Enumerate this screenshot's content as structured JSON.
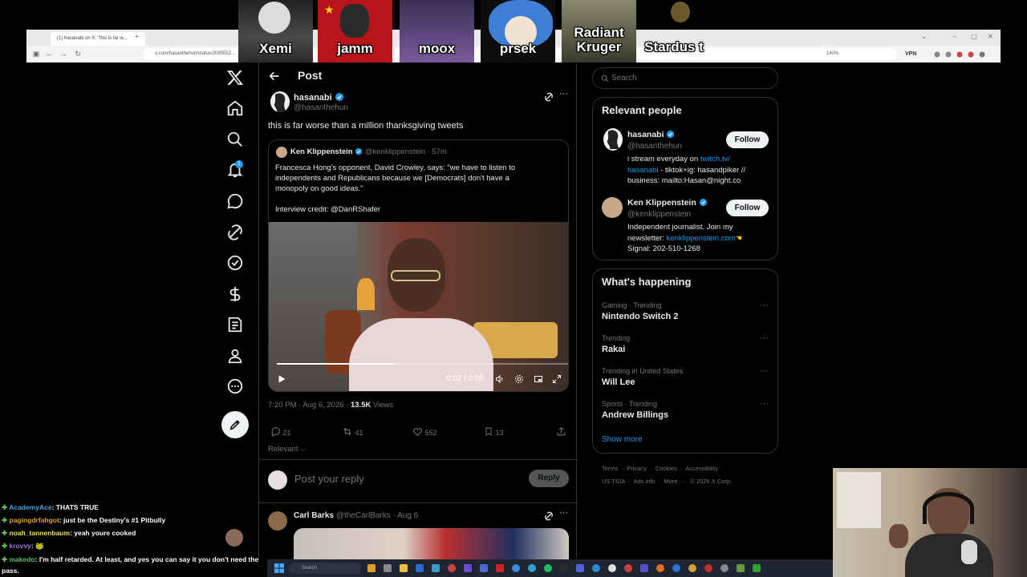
{
  "browser": {
    "tab_title": "(1) hasanabi on X: \"this is far w...",
    "url": "x.com/hasanthehun/status/2085552...",
    "zoom": "140%",
    "vpn": "VPN"
  },
  "streamer_tiles": [
    {
      "name": "Xemi",
      "color": "#3a3a3a"
    },
    {
      "name": "jamm",
      "color": "#b8141c"
    },
    {
      "name": "moox",
      "color": "#5a4a7a"
    },
    {
      "name": "prsek",
      "color": "#3d7fd6"
    },
    {
      "name": "Radiant Kruger",
      "color": "#6a6a58"
    },
    {
      "name": "Stardus t",
      "color": "#111111"
    }
  ],
  "nav": {
    "items": [
      "x-logo-icon",
      "home-icon",
      "search-icon",
      "notifications-icon",
      "messages-icon",
      "grok-icon",
      "verified-icon",
      "monetization-icon",
      "articles-icon",
      "profile-icon",
      "more-icon"
    ],
    "notification_count": "1",
    "post_button_icon": "compose-icon"
  },
  "header": {
    "title": "Post"
  },
  "post": {
    "author_name": "hasanabi",
    "author_handle": "@hasanthehun",
    "text": "this is far worse than a million thanksgiving tweets",
    "timestamp": "7:20 PM · Aug 6, 2026 · ",
    "views_count": "13.5K",
    "views_label": " Views",
    "quote": {
      "author_name": "Ken Klippenstein",
      "author_handle": "@kenklippenstein",
      "time": "· 57m",
      "text_line1": "Francesca Hong's opponent, David Crowley, says: \"we have to listen to",
      "text_line2": "independents and Republicans because we [Democrats] don't have a",
      "text_line3": "monopoly on good ideas.\"",
      "credit": "Interview credit: @DanRShafer"
    },
    "video": {
      "time": "0:02 / 0:05",
      "progress": 0.4
    },
    "actions": {
      "replies": "21",
      "reposts": "41",
      "likes": "552",
      "bookmarks": "13"
    },
    "sort_label": "Relevant"
  },
  "reply_box": {
    "placeholder": "Post your reply",
    "button": "Reply"
  },
  "reply_post": {
    "author_name": "Carl Barks",
    "author_handle": "@theCarlBarks",
    "time": "· Aug 6"
  },
  "search": {
    "placeholder": "Search"
  },
  "relevant_people": {
    "title": "Relevant people",
    "people": [
      {
        "name": "hasanabi",
        "handle": "@hasanthehun",
        "follow": "Follow",
        "bio1": "i stream everyday on ",
        "bio_link1": "twitch.tv/",
        "bio_link2": "hasanabi",
        "bio2": " - tiktok+ig: hasandpiker //",
        "bio3": "business: mailto:Hasan@night.co"
      },
      {
        "name": "Ken Klippenstein",
        "handle": "@kenklippenstein",
        "follow": "Follow",
        "bio1": "Independent journalist. Join my",
        "bio2": "newsletter: ",
        "bio_link1": "kenklippenstein.com",
        "bio3": "Signal: 202-510-1268"
      }
    ]
  },
  "whats_happening": {
    "title": "What's happening",
    "trends": [
      {
        "category": "Gaming · Trending",
        "name": "Nintendo Switch 2"
      },
      {
        "category": "Trending",
        "name": "Rakai"
      },
      {
        "category": "Trending in United States",
        "name": "Will Lee"
      },
      {
        "category": "Sports · Trending",
        "name": "Andrew Billings"
      }
    ],
    "show_more": "Show more"
  },
  "footer": {
    "line1": [
      "Terms",
      "Privacy",
      "Cookies",
      "Accessibility"
    ],
    "line2": [
      "US TIDA",
      "Ads info",
      "More ···",
      "© 2026 X Corp."
    ]
  },
  "chat": [
    {
      "user": "AcademyAce",
      "color": "#4aa3df",
      "msg": ": THATS TRUE"
    },
    {
      "user": "pagingdrfahgot",
      "color": "#e0a030",
      "msg": ": just be the Destiny's #1 Pitbully"
    },
    {
      "user": "noah_tannenbaum",
      "color": "#f0e060",
      "msg": ": yeah youre cooked"
    },
    {
      "user": "krovvy",
      "color": "#a070e0",
      "msg": ": 🐸"
    },
    {
      "user": "makedo",
      "color": "#60c060",
      "msg": ": I'm half retarded. At least, and yes you can say it you don't need the"
    },
    {
      "user": "",
      "color": "#ffffff",
      "msg": "pass."
    }
  ],
  "taskbar": {
    "search_placeholder": "Search"
  }
}
